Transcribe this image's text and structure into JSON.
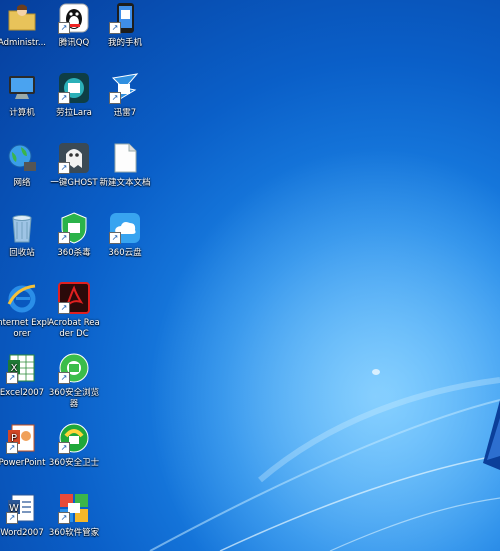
{
  "desktop": {
    "icons": [
      {
        "label": "Administr...",
        "icon": "user-folder-icon"
      },
      {
        "label": "腾讯QQ",
        "icon": "qq-penguin-icon"
      },
      {
        "label": "我的手机",
        "icon": "phone-icon"
      },
      {
        "label": "计算机",
        "icon": "computer-icon"
      },
      {
        "label": "劳拉Lara",
        "icon": "lara-icon"
      },
      {
        "label": "迅雷7",
        "icon": "thunder-icon"
      },
      {
        "label": "网络",
        "icon": "network-globe-icon"
      },
      {
        "label": "一键GHOST",
        "icon": "ghost-icon"
      },
      {
        "label": "新建文本文档",
        "icon": "text-document-icon"
      },
      {
        "label": "回收站",
        "icon": "recycle-bin-icon"
      },
      {
        "label": "360杀毒",
        "icon": "360-antivirus-icon"
      },
      {
        "label": "360云盘",
        "icon": "360-cloud-icon"
      },
      {
        "label": "Internet Explorer",
        "icon": "internet-explorer-icon"
      },
      {
        "label": "Acrobat Reader DC",
        "icon": "acrobat-reader-icon"
      },
      {
        "label": "Excel2007",
        "icon": "excel-icon"
      },
      {
        "label": "360安全浏览器",
        "icon": "360-browser-icon"
      },
      {
        "label": "PowerPoint",
        "icon": "powerpoint-icon"
      },
      {
        "label": "360安全卫士",
        "icon": "360-security-icon"
      },
      {
        "label": "Word2007",
        "icon": "word-icon"
      },
      {
        "label": "360软件管家",
        "icon": "360-software-manager-icon"
      }
    ]
  }
}
